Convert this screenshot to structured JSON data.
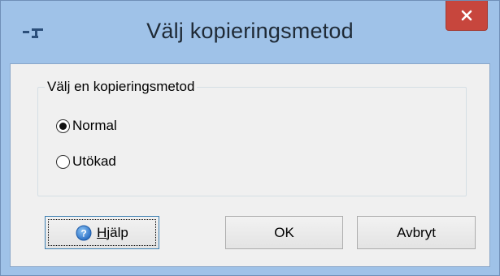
{
  "window": {
    "title": "Välj kopieringsmetod",
    "close_icon": "close-icon",
    "app_icon": "app-icon"
  },
  "group": {
    "label": "Välj en kopieringsmetod",
    "options": [
      {
        "label": "Normal",
        "selected": true
      },
      {
        "label": "Utökad",
        "selected": false
      }
    ]
  },
  "buttons": {
    "help_label": "Hjälp",
    "help_icon": "help-icon",
    "ok_label": "OK",
    "cancel_label": "Avbryt"
  },
  "colors": {
    "frame": "#9fc2e8",
    "close": "#c7463d",
    "client": "#f0f0f0"
  }
}
